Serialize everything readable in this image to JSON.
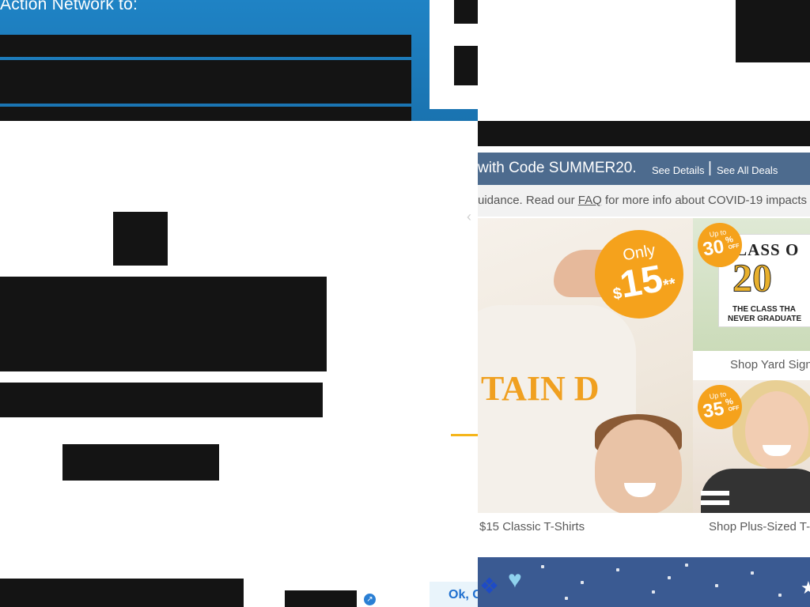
{
  "background_page": {
    "hero_heading": "Action Network to:",
    "consent_button": "Ok, C",
    "external_icon": "external-link-icon"
  },
  "shop": {
    "promo": {
      "main": "with Code SUMMER20.",
      "details_link": "See Details",
      "separator": "|",
      "deals_link": "See All Deals",
      "background": "#4d6b8e"
    },
    "covid": {
      "prefix": "uidance. Read our ",
      "faq_link": "FAQ",
      "suffix": " for more info about COVID-19 impacts"
    },
    "tiles": {
      "classic": {
        "badge_top": "Only",
        "badge_currency": "$",
        "badge_price": "15",
        "badge_mark": "**",
        "shirt_print": "TAIN D",
        "label": "$15 Classic T-Shirts"
      },
      "yard": {
        "badge_upto": "Up to",
        "badge_pct": "30",
        "badge_pct_sign": "%",
        "badge_off": "OFF",
        "sign_line1": "CLASS O",
        "sign_number": "20",
        "sign_line2": "THE CLASS THA",
        "sign_line3": "NEVER GRADUATE",
        "label": "Shop Yard Sign"
      },
      "plus": {
        "badge_upto": "Up to",
        "badge_pct": "35",
        "badge_pct_sign": "%",
        "badge_off": "OFF",
        "label": "Shop Plus-Sized T-"
      }
    },
    "accent_color": "#f5a21c"
  }
}
